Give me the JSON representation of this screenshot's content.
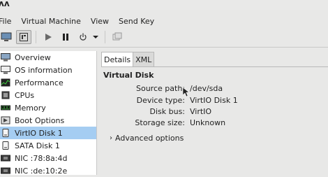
{
  "app": {
    "title": "ʌʌ"
  },
  "menu": [
    "File",
    "Virtual Machine",
    "View",
    "Send Key"
  ],
  "toolbar": {
    "buttons": [
      "console-icon",
      "details-icon",
      "run-icon",
      "pause-icon",
      "shutdown-icon",
      "dropdown-icon",
      "screenshot-icon"
    ]
  },
  "sidebar": {
    "items": [
      {
        "label": "Overview",
        "icon": "monitor-icon"
      },
      {
        "label": "OS information",
        "icon": "info-icon"
      },
      {
        "label": "Performance",
        "icon": "chart-icon"
      },
      {
        "label": "CPUs",
        "icon": "cpu-icon"
      },
      {
        "label": "Memory",
        "icon": "memory-icon"
      },
      {
        "label": "Boot Options",
        "icon": "boot-icon"
      },
      {
        "label": "VirtIO Disk 1",
        "icon": "disk-icon",
        "selected": true
      },
      {
        "label": "SATA Disk 1",
        "icon": "disk-icon"
      },
      {
        "label": "NIC :78:8a:4d",
        "icon": "nic-icon"
      },
      {
        "label": "NIC :de:10:2e",
        "icon": "nic-icon"
      }
    ]
  },
  "tabs": [
    "Details",
    "XML"
  ],
  "details": {
    "title": "Virtual Disk",
    "rows": [
      {
        "label": "Source path:",
        "value": "/dev/sda"
      },
      {
        "label": "Device type:",
        "value": "VirtIO Disk 1"
      },
      {
        "label": "Disk bus:",
        "value": "VirtIO"
      },
      {
        "label": "Storage size:",
        "value": "Unknown"
      }
    ],
    "advanced": "Advanced options"
  },
  "colors": {
    "selection": "#a5cdf2",
    "background": "#e8e8e7"
  }
}
